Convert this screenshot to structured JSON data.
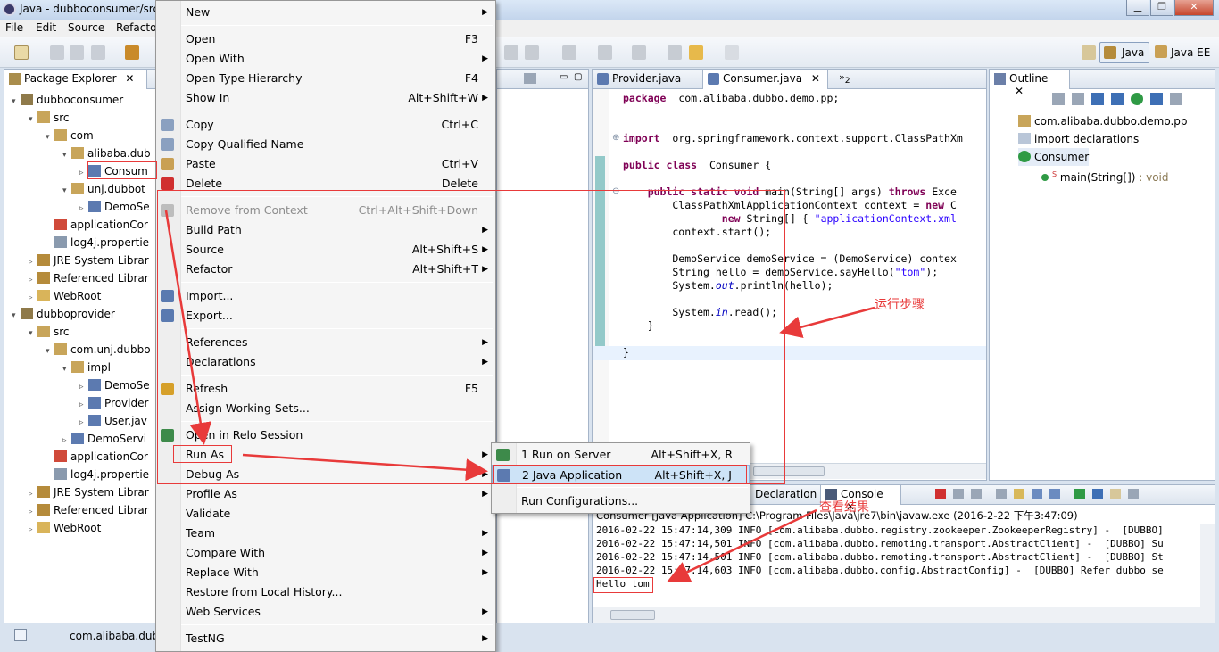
{
  "window": {
    "title": "Java - dubboconsumer/src"
  },
  "menubar": {
    "items": [
      "File",
      "Edit",
      "Source",
      "Refacto"
    ]
  },
  "perspectives": {
    "java": "Java",
    "java_ee": "Java EE"
  },
  "package_explorer": {
    "tab_label": "Package Explorer",
    "tree": [
      {
        "label": "dubboconsumer",
        "level": 0,
        "icon": "project-icon",
        "arrow": "▾"
      },
      {
        "label": "src",
        "level": 1,
        "icon": "src-folder-icon",
        "arrow": "▾"
      },
      {
        "label": "com",
        "level": 2,
        "icon": "package-icon",
        "arrow": "▾"
      },
      {
        "label": "alibaba.dub",
        "level": 3,
        "icon": "package-icon",
        "arrow": "▾"
      },
      {
        "label": "Consum",
        "level": 4,
        "icon": "java-file-icon",
        "arrow": "▹"
      },
      {
        "label": "unj.dubbot",
        "level": 3,
        "icon": "package-icon",
        "arrow": "▾"
      },
      {
        "label": "DemoSe",
        "level": 4,
        "icon": "java-file-icon",
        "arrow": "▹"
      },
      {
        "label": "applicationCor",
        "level": 2,
        "icon": "xml-file-icon",
        "arrow": ""
      },
      {
        "label": "log4j.propertie",
        "level": 2,
        "icon": "properties-file-icon",
        "arrow": ""
      },
      {
        "label": "JRE System Librar",
        "level": 1,
        "icon": "library-icon",
        "arrow": "▹"
      },
      {
        "label": "Referenced Librar",
        "level": 1,
        "icon": "library-icon",
        "arrow": "▹"
      },
      {
        "label": "WebRoot",
        "level": 1,
        "icon": "folder-icon",
        "arrow": "▹"
      },
      {
        "label": "dubboprovider",
        "level": 0,
        "icon": "project-icon",
        "arrow": "▾"
      },
      {
        "label": "src",
        "level": 1,
        "icon": "src-folder-icon",
        "arrow": "▾"
      },
      {
        "label": "com.unj.dubbo",
        "level": 2,
        "icon": "package-icon",
        "arrow": "▾"
      },
      {
        "label": "impl",
        "level": 3,
        "icon": "package-icon",
        "arrow": "▾"
      },
      {
        "label": "DemoSe",
        "level": 4,
        "icon": "java-file-icon",
        "arrow": "▹"
      },
      {
        "label": "Provider",
        "level": 4,
        "icon": "java-file-icon",
        "arrow": "▹"
      },
      {
        "label": "User.jav",
        "level": 4,
        "icon": "java-file-icon",
        "arrow": "▹"
      },
      {
        "label": "DemoServi",
        "level": 3,
        "icon": "java-file-icon",
        "arrow": "▹"
      },
      {
        "label": "applicationCor",
        "level": 2,
        "icon": "xml-file-icon",
        "arrow": ""
      },
      {
        "label": "log4j.propertie",
        "level": 2,
        "icon": "properties-file-icon",
        "arrow": ""
      },
      {
        "label": "JRE System Librar",
        "level": 1,
        "icon": "library-icon",
        "arrow": "▹"
      },
      {
        "label": "Referenced Librar",
        "level": 1,
        "icon": "library-icon",
        "arrow": "▹"
      },
      {
        "label": "WebRoot",
        "level": 1,
        "icon": "folder-icon",
        "arrow": "▹"
      }
    ]
  },
  "status": {
    "text": "com.alibaba.dub"
  },
  "context_menu": {
    "items": [
      {
        "label": "New",
        "shortcut": "",
        "submenu": true,
        "disabled": false
      },
      {
        "sep": true
      },
      {
        "label": "Open",
        "shortcut": "F3",
        "submenu": false,
        "disabled": false
      },
      {
        "label": "Open With",
        "shortcut": "",
        "submenu": true,
        "disabled": false
      },
      {
        "label": "Open Type Hierarchy",
        "shortcut": "F4",
        "submenu": false,
        "disabled": false
      },
      {
        "label": "Show In",
        "shortcut": "Alt+Shift+W",
        "submenu": true,
        "disabled": false
      },
      {
        "sep": true
      },
      {
        "label": "Copy",
        "shortcut": "Ctrl+C",
        "submenu": false,
        "disabled": false,
        "icon": "copy-icon"
      },
      {
        "label": "Copy Qualified Name",
        "shortcut": "",
        "submenu": false,
        "disabled": false,
        "icon": "copy-qualified-icon"
      },
      {
        "label": "Paste",
        "shortcut": "Ctrl+V",
        "submenu": false,
        "disabled": false,
        "icon": "paste-icon"
      },
      {
        "label": "Delete",
        "shortcut": "Delete",
        "submenu": false,
        "disabled": false,
        "icon": "delete-icon"
      },
      {
        "sep": true
      },
      {
        "label": "Remove from Context",
        "shortcut": "Ctrl+Alt+Shift+Down",
        "submenu": false,
        "disabled": true,
        "icon": "remove-context-icon"
      },
      {
        "label": "Build Path",
        "shortcut": "",
        "submenu": true,
        "disabled": false
      },
      {
        "label": "Source",
        "shortcut": "Alt+Shift+S",
        "submenu": true,
        "disabled": false
      },
      {
        "label": "Refactor",
        "shortcut": "Alt+Shift+T",
        "submenu": true,
        "disabled": false
      },
      {
        "sep": true
      },
      {
        "label": "Import...",
        "shortcut": "",
        "submenu": false,
        "disabled": false,
        "icon": "import-icon"
      },
      {
        "label": "Export...",
        "shortcut": "",
        "submenu": false,
        "disabled": false,
        "icon": "export-icon"
      },
      {
        "sep": true
      },
      {
        "label": "References",
        "shortcut": "",
        "submenu": true,
        "disabled": false
      },
      {
        "label": "Declarations",
        "shortcut": "",
        "submenu": true,
        "disabled": false
      },
      {
        "sep": true
      },
      {
        "label": "Refresh",
        "shortcut": "F5",
        "submenu": false,
        "disabled": false,
        "icon": "refresh-icon"
      },
      {
        "label": "Assign Working Sets...",
        "shortcut": "",
        "submenu": false,
        "disabled": false
      },
      {
        "sep": true
      },
      {
        "label": "Open in Relo Session",
        "shortcut": "",
        "submenu": false,
        "disabled": false,
        "icon": "relo-icon"
      },
      {
        "label": "Run As",
        "shortcut": "",
        "submenu": true,
        "disabled": false,
        "highlight": true
      },
      {
        "label": "Debug As",
        "shortcut": "",
        "submenu": true,
        "disabled": false
      },
      {
        "label": "Profile As",
        "shortcut": "",
        "submenu": true,
        "disabled": false
      },
      {
        "label": "Validate",
        "shortcut": "",
        "submenu": false,
        "disabled": false
      },
      {
        "label": "Team",
        "shortcut": "",
        "submenu": true,
        "disabled": false
      },
      {
        "label": "Compare With",
        "shortcut": "",
        "submenu": true,
        "disabled": false
      },
      {
        "label": "Replace With",
        "shortcut": "",
        "submenu": true,
        "disabled": false
      },
      {
        "label": "Restore from Local History...",
        "shortcut": "",
        "submenu": false,
        "disabled": false
      },
      {
        "label": "Web Services",
        "shortcut": "",
        "submenu": true,
        "disabled": false
      },
      {
        "sep": true
      },
      {
        "label": "TestNG",
        "shortcut": "",
        "submenu": true,
        "disabled": false
      }
    ]
  },
  "run_as_submenu": {
    "items": [
      {
        "label": "1 Run on Server",
        "shortcut": "Alt+Shift+X, R",
        "icon": "run-server-icon"
      },
      {
        "label": "2 Java Application",
        "shortcut": "Alt+Shift+X, J",
        "icon": "java-app-icon",
        "selected": true
      },
      {
        "sep": true
      },
      {
        "label": "Run Configurations...",
        "shortcut": ""
      }
    ]
  },
  "editor": {
    "tabs": [
      "Provider.java",
      "Consumer.java"
    ],
    "overflow": "2",
    "lines": [
      [
        [
          "kw",
          "package"
        ],
        [
          "",
          "  com.alibaba.dubbo.demo.pp;"
        ]
      ],
      [],
      [],
      [
        [
          "kw",
          "import"
        ],
        [
          "",
          "  org.springframework.context.support.ClassPathXm"
        ]
      ],
      [],
      [
        [
          "kw",
          "public class"
        ],
        [
          "",
          "  Consumer {"
        ]
      ],
      [],
      [
        [
          "",
          "    "
        ],
        [
          "kw",
          "public static void"
        ],
        [
          "",
          " main(String[] args) "
        ],
        [
          "kw",
          "throws"
        ],
        [
          "",
          " Exce"
        ]
      ],
      [
        [
          "",
          "        ClassPathXmlApplicationContext context = "
        ],
        [
          "kw",
          "new"
        ],
        [
          "",
          " C"
        ]
      ],
      [
        [
          "",
          "                "
        ],
        [
          "kw",
          "new"
        ],
        [
          "",
          " String[] { "
        ],
        [
          "str",
          "\"applicationContext.xml"
        ]
      ],
      [
        [
          "",
          "        context.start();"
        ]
      ],
      [],
      [
        [
          "",
          "        DemoService demoService = (DemoService) contex"
        ]
      ],
      [
        [
          "",
          "        String hello = demoService.sayHello("
        ],
        [
          "str",
          "\"tom\""
        ],
        [
          "",
          ");"
        ]
      ],
      [
        [
          "",
          "        System."
        ],
        [
          "fld",
          "out"
        ],
        [
          "",
          ".println(hello);"
        ]
      ],
      [],
      [
        [
          "",
          "        System."
        ],
        [
          "fld",
          "in"
        ],
        [
          "",
          ".read();"
        ]
      ],
      [
        [
          "",
          "    }"
        ]
      ],
      [],
      [
        [
          "",
          "}"
        ]
      ]
    ]
  },
  "outline": {
    "tab_label": "Outline",
    "items": [
      {
        "label": "com.alibaba.dubbo.demo.pp",
        "icon": "package-icon"
      },
      {
        "label": "import declarations",
        "icon": "imports-icon"
      },
      {
        "label": "Consumer",
        "icon": "class-icon"
      },
      {
        "label": "main(String[])",
        "suffix": " : void",
        "icon": "method-icon"
      }
    ]
  },
  "console": {
    "tabs": [
      "Declaration",
      "Console"
    ],
    "header": "Consumer [Java Application] C:\\Program Files\\Java\\jre7\\bin\\javaw.exe (2016-2-22 下午3:47:09)",
    "lines": [
      "2016-02-22 15:47:14,309 INFO [com.alibaba.dubbo.registry.zookeeper.ZookeeperRegistry] -  [DUBBO]",
      "2016-02-22 15:47:14,501 INFO [com.alibaba.dubbo.remoting.transport.AbstractClient] -  [DUBBO] Su",
      "2016-02-22 15:47:14,501 INFO [com.alibaba.dubbo.remoting.transport.AbstractClient] -  [DUBBO] St",
      "2016-02-22 15:47:14,603 INFO [com.alibaba.dubbo.config.AbstractConfig] -  [DUBBO] Refer dubbo se",
      "Hello tom"
    ]
  },
  "annotations": {
    "run_steps": "运行步骤",
    "view_result": "查看结果"
  },
  "colors": {
    "annotation_red": "#e83a3a",
    "selection_blue": "#cde3f7"
  }
}
